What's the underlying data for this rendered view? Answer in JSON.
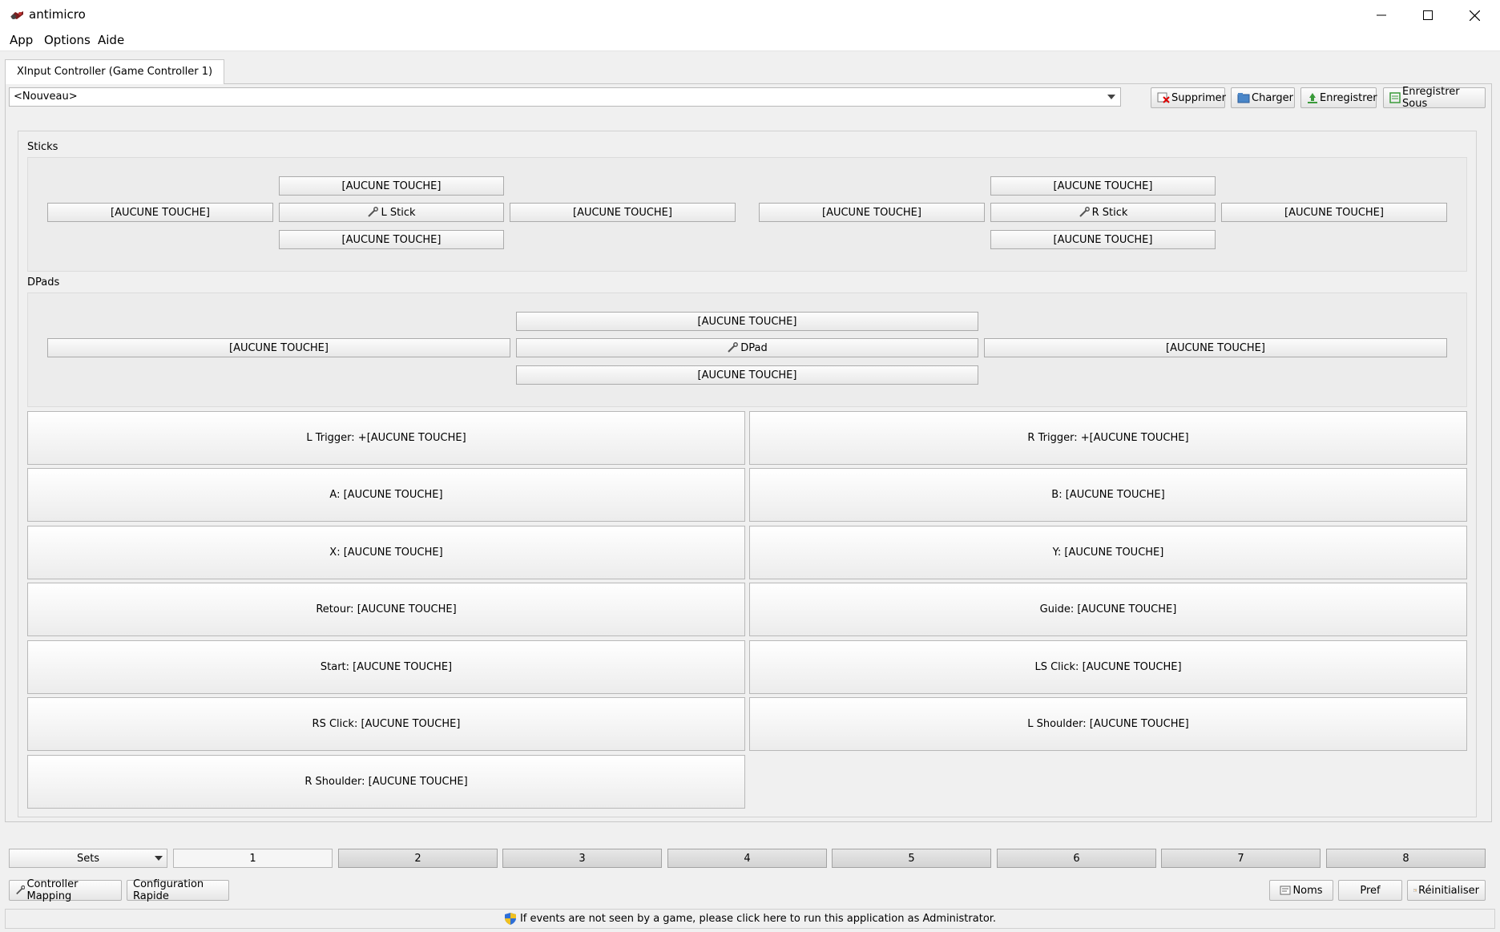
{
  "window": {
    "title": "antimicro"
  },
  "menu": {
    "app": "App",
    "options": "Options",
    "help": "Aide"
  },
  "tab": {
    "label": "XInput Controller (Game Controller 1)"
  },
  "profile": {
    "selected": "<Nouveau>"
  },
  "toolbar": {
    "delete": "Supprimer",
    "load": "Charger",
    "save": "Enregistrer",
    "save_as": "Enregistrer Sous"
  },
  "sticks": {
    "label": "Sticks",
    "left": {
      "up": "[AUCUNE TOUCHE]",
      "left": "[AUCUNE TOUCHE]",
      "center": "L Stick",
      "right": "[AUCUNE TOUCHE]",
      "down": "[AUCUNE TOUCHE]"
    },
    "right": {
      "up": "[AUCUNE TOUCHE]",
      "left": "[AUCUNE TOUCHE]",
      "center": "R Stick",
      "right": "[AUCUNE TOUCHE]",
      "down": "[AUCUNE TOUCHE]"
    }
  },
  "dpads": {
    "label": "DPads",
    "up": "[AUCUNE TOUCHE]",
    "left": "[AUCUNE TOUCHE]",
    "center": "DPad",
    "right": "[AUCUNE TOUCHE]",
    "down": "[AUCUNE TOUCHE]"
  },
  "buttons": [
    "L Trigger: +[AUCUNE TOUCHE]",
    "R Trigger: +[AUCUNE TOUCHE]",
    "A: [AUCUNE TOUCHE]",
    "B: [AUCUNE TOUCHE]",
    "X: [AUCUNE TOUCHE]",
    "Y: [AUCUNE TOUCHE]",
    "Retour: [AUCUNE TOUCHE]",
    "Guide: [AUCUNE TOUCHE]",
    "Start: [AUCUNE TOUCHE]",
    "LS Click: [AUCUNE TOUCHE]",
    "RS Click: [AUCUNE TOUCHE]",
    "L Shoulder: [AUCUNE TOUCHE]",
    "R Shoulder: [AUCUNE TOUCHE]"
  ],
  "sets": {
    "selector": "Sets",
    "items": [
      "1",
      "2",
      "3",
      "4",
      "5",
      "6",
      "7",
      "8"
    ],
    "active": "1"
  },
  "bottom": {
    "controller_mapping": "Controller Mapping",
    "quick_config": "Configuration Rapide",
    "names": "Noms",
    "prefs": "Pref",
    "reset": "Réinitialiser"
  },
  "status": {
    "message": "If events are not seen by a game, please click here to run this application as Administrator."
  }
}
